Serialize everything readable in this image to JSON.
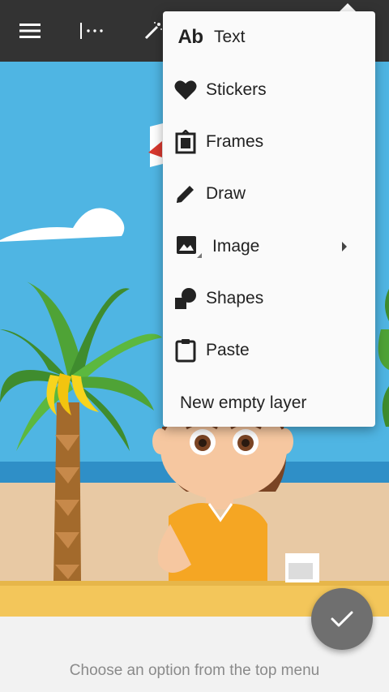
{
  "toolbar": {
    "icons": [
      "menu-icon",
      "layers-dots-icon",
      "magic-wand-icon"
    ]
  },
  "menu": {
    "items": [
      {
        "label": "Text",
        "icon": "text-ab-icon",
        "icon_text": "Ab"
      },
      {
        "label": "Stickers",
        "icon": "heart-icon"
      },
      {
        "label": "Frames",
        "icon": "frame-icon"
      },
      {
        "label": "Draw",
        "icon": "pencil-icon"
      },
      {
        "label": "Image",
        "icon": "image-icon",
        "submenu": true
      },
      {
        "label": "Shapes",
        "icon": "shapes-icon"
      },
      {
        "label": "Paste",
        "icon": "clipboard-icon"
      },
      {
        "label": "New empty layer"
      }
    ]
  },
  "hint": "Choose an option from the top menu",
  "colors": {
    "toolbar": "#333333",
    "sky": "#4fb5e3",
    "sand": "#e8c9a4",
    "fab": "#6f6f6f"
  }
}
